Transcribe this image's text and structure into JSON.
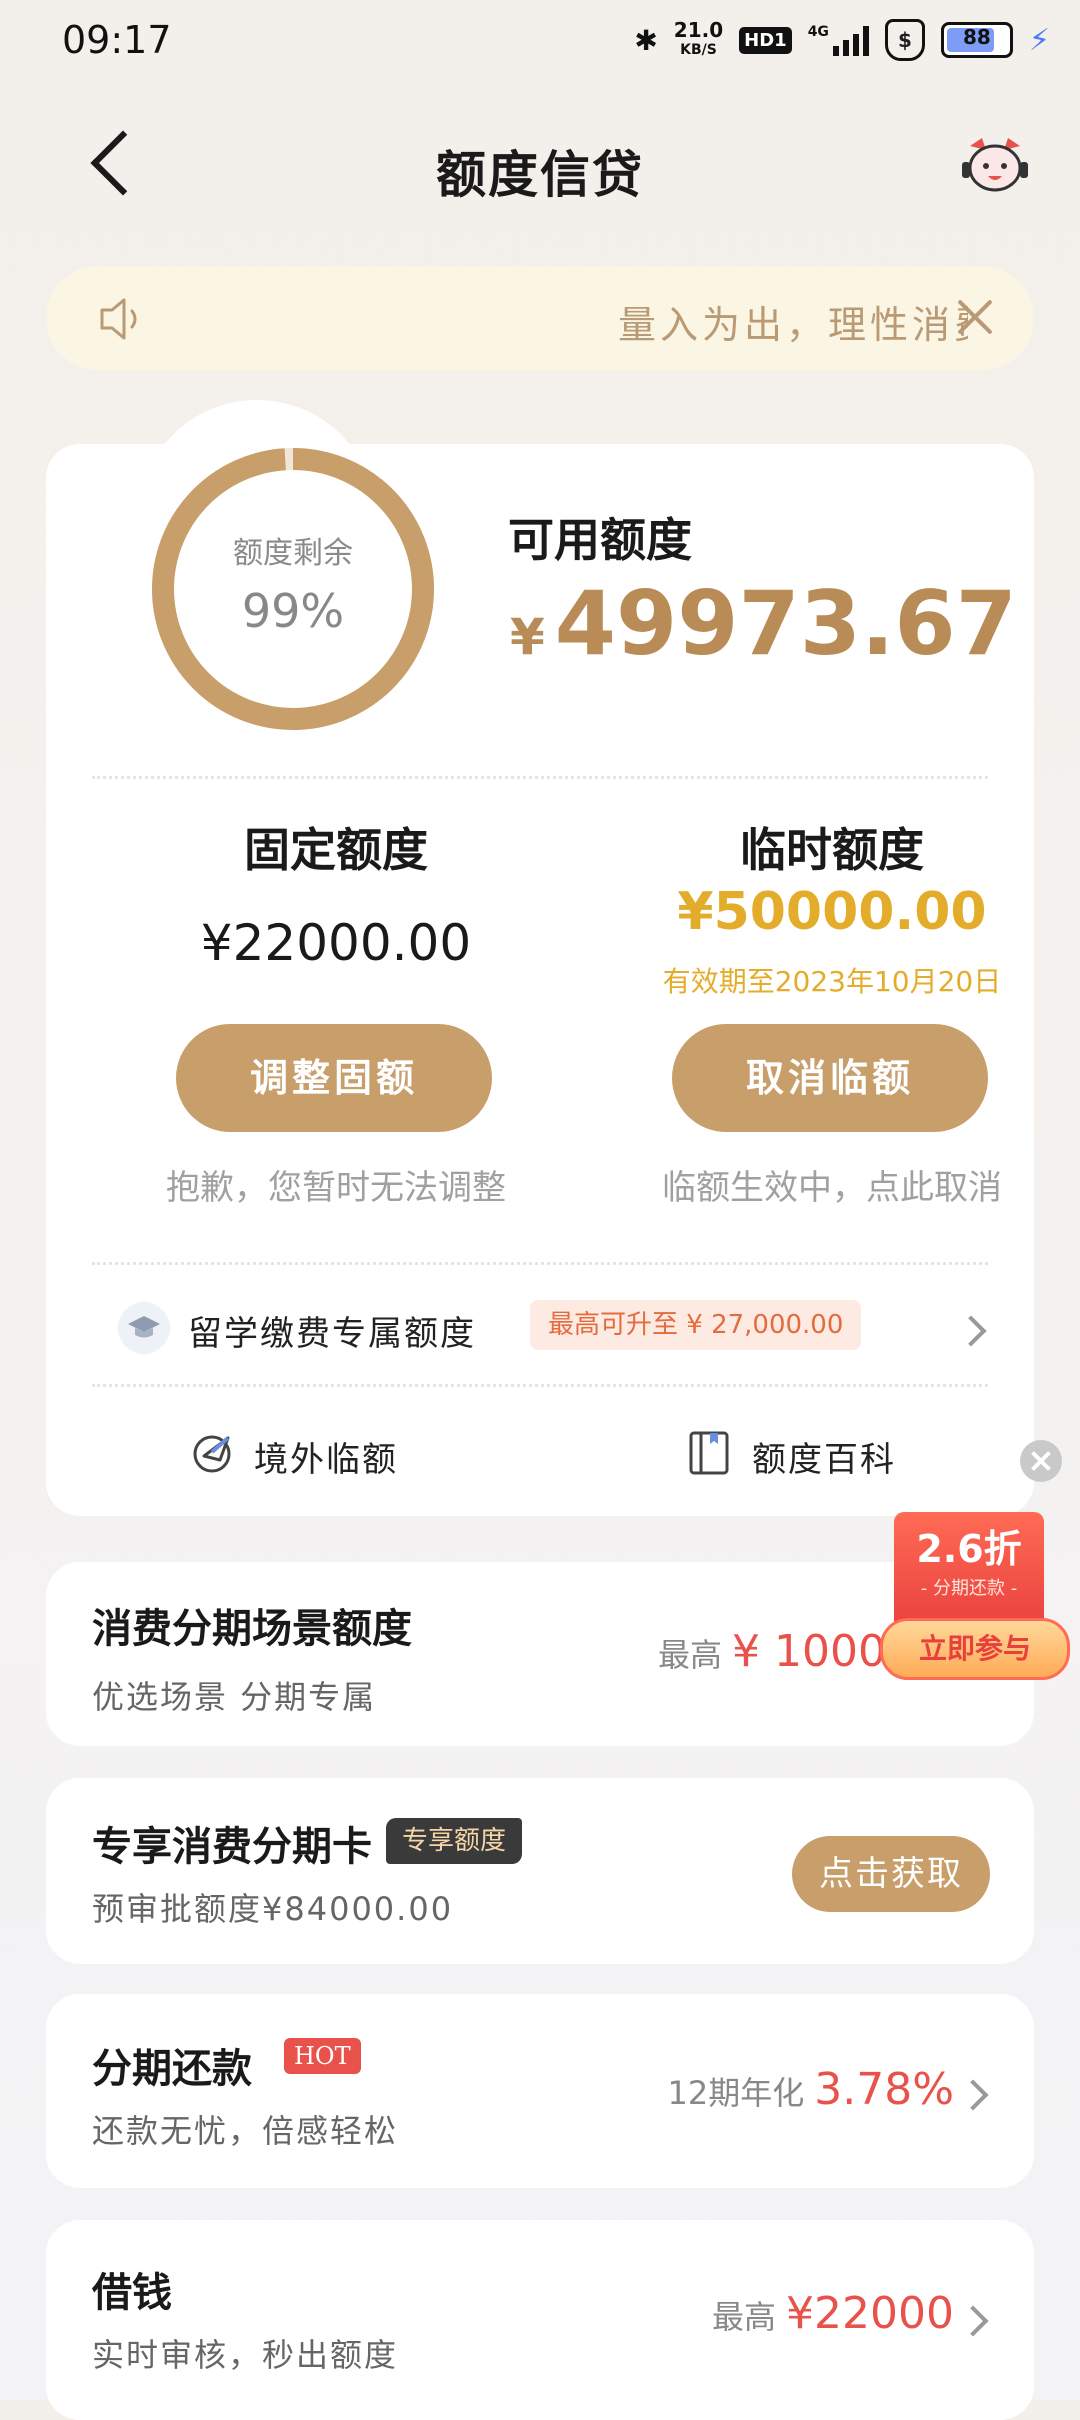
{
  "status_bar": {
    "time": "09:17",
    "net_speed": "21.0",
    "net_unit": "KB/S",
    "hd_badge": "HD1",
    "network": "4G",
    "shield": "$",
    "battery": "88",
    "battery_percent": 88
  },
  "header": {
    "title": "额度信贷"
  },
  "notice": {
    "text": "量入为出，理性消费"
  },
  "credit": {
    "ring_label": "额度剩余",
    "ring_value": "99%",
    "ring_fraction": 0.99,
    "available_label": "可用额度",
    "available_currency": "¥",
    "available_amount": "49973.67",
    "fixed_title": "固定额度",
    "fixed_amount": "¥22000.00",
    "fixed_button": "调整固额",
    "fixed_note": "抱歉，您暂时无法调整",
    "temp_title": "临时额度",
    "temp_amount": "¥50000.00",
    "temp_valid": "有效期至2023年10月20日",
    "temp_button": "取消临额",
    "temp_note": "临额生效中，点此取消",
    "study_label": "留学缴费专属额度",
    "study_tag": "最高可升至 ¥ 27,000.00",
    "overseas_label": "境外临额",
    "wiki_label": "额度百科"
  },
  "cards": {
    "consume": {
      "title": "消费分期场景额度",
      "sub": "优选场景 分期专属",
      "right_prefix": "最高",
      "right_value": "¥ 10000"
    },
    "exclusive": {
      "title": "专享消费分期卡",
      "tag": "专享额度",
      "sub": "预审批额度¥84000.00",
      "button": "点击获取"
    },
    "installment": {
      "title": "分期还款",
      "tag": "HOT",
      "sub": "还款无忧，倍感轻松",
      "right_prefix": "12期年化",
      "right_value": "3.78%"
    },
    "borrow": {
      "title": "借钱",
      "sub": "实时审核，秒出额度",
      "right_prefix": "最高",
      "right_value": "¥22000"
    }
  },
  "promo": {
    "discount": "2.6折",
    "subtitle": "- 分期还款 -",
    "button": "立即参与"
  },
  "colors": {
    "accent": "#c89e6b",
    "gold": "#e3ad2b",
    "red": "#e8524a"
  }
}
